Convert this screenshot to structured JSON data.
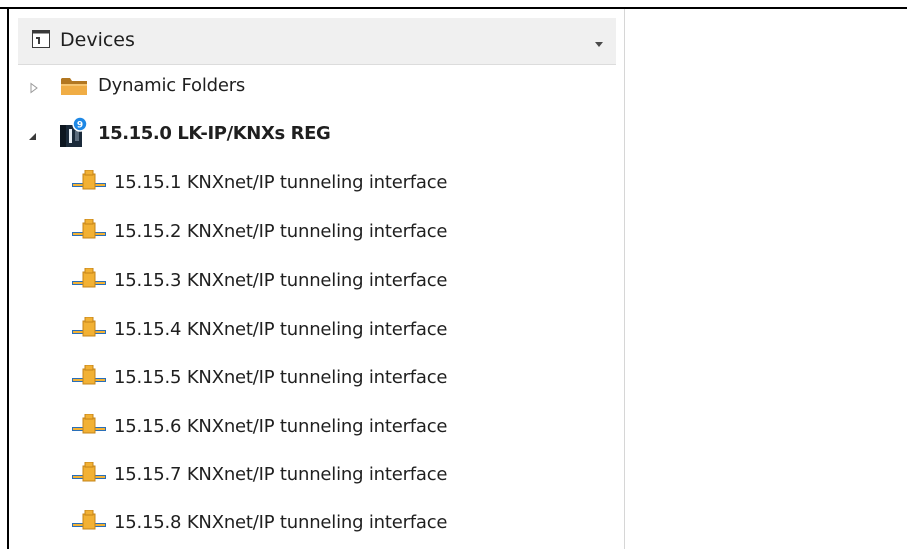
{
  "panel": {
    "title": "Devices",
    "title_icon": "panel-window-icon",
    "dropdown_icon": "dropdown-arrow-icon"
  },
  "tree": {
    "folders": [
      {
        "label": "Dynamic Folders",
        "icon": "folder-icon",
        "expanded": false
      }
    ],
    "device": {
      "label": "15.15.0  LK-IP/KNXs REG",
      "icon": "ip-router-device-icon",
      "expanded": true
    },
    "interfaces": [
      {
        "label": "15.15.1 KNXnet/IP tunneling interface",
        "icon": "tunneling-interface-icon"
      },
      {
        "label": "15.15.2 KNXnet/IP tunneling interface",
        "icon": "tunneling-interface-icon"
      },
      {
        "label": "15.15.3 KNXnet/IP tunneling interface",
        "icon": "tunneling-interface-icon"
      },
      {
        "label": "15.15.4 KNXnet/IP tunneling interface",
        "icon": "tunneling-interface-icon"
      },
      {
        "label": "15.15.5 KNXnet/IP tunneling interface",
        "icon": "tunneling-interface-icon"
      },
      {
        "label": "15.15.6 KNXnet/IP tunneling interface",
        "icon": "tunneling-interface-icon"
      },
      {
        "label": "15.15.7 KNXnet/IP tunneling interface",
        "icon": "tunneling-interface-icon"
      },
      {
        "label": "15.15.8 KNXnet/IP tunneling interface",
        "icon": "tunneling-interface-icon"
      }
    ]
  },
  "colors": {
    "folder": "#e8a33d",
    "device_dark": "#1b2a3a",
    "device_badge": "#1e88e5",
    "interface_orange": "#f2b134",
    "interface_blue": "#2a6fb8"
  }
}
